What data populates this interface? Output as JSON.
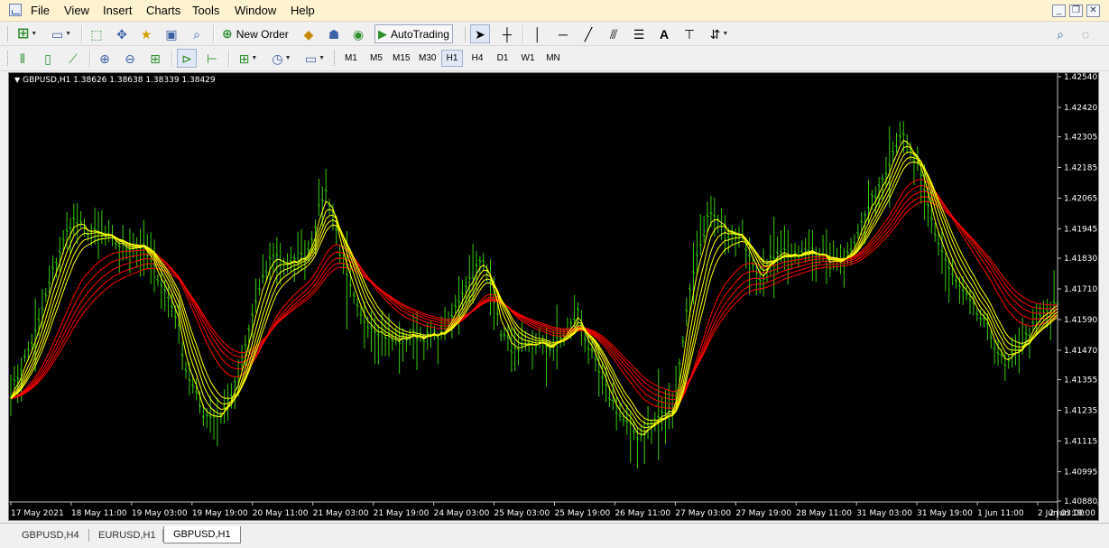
{
  "menubar": {
    "items": [
      "File",
      "View",
      "Insert",
      "Charts",
      "Tools",
      "Window",
      "Help"
    ],
    "window_controls": [
      "minimize",
      "restore",
      "close"
    ]
  },
  "toolbar": {
    "new_order_label": "New Order",
    "autotrading_label": "AutoTrading",
    "timeframes": [
      "M1",
      "M5",
      "M15",
      "M30",
      "H1",
      "H4",
      "D1",
      "W1",
      "MN"
    ],
    "active_timeframe": "H1",
    "text_tool_label": "A"
  },
  "chart": {
    "title": "GBPUSD,H1  1.38626 1.38638 1.38339 1.38429",
    "colors": {
      "background": "#000000",
      "bars": "#33cc00",
      "fast_ma": "#ffff00",
      "slow_ma": "#ff0000"
    }
  },
  "chart_data": {
    "type": "line",
    "symbol": "GBPUSD",
    "timeframe": "H1",
    "ohlc_header": [
      1.38626,
      1.38638,
      1.38339,
      1.38429
    ],
    "x_tick_labels": [
      "17 May 2021",
      "18 May 11:00",
      "19 May 03:00",
      "19 May 19:00",
      "20 May 11:00",
      "21 May 03:00",
      "21 May 19:00",
      "24 May 03:00",
      "25 May 03:00",
      "25 May 19:00",
      "26 May 11:00",
      "27 May 03:00",
      "27 May 19:00",
      "28 May 11:00",
      "31 May 03:00",
      "31 May 19:00",
      "1 Jun 11:00",
      "2 Jun 03:00",
      "2 Jun 19:00"
    ],
    "y_tick_labels": [
      "1.42540",
      "1.42420",
      "1.42305",
      "1.42185",
      "1.42065",
      "1.41945",
      "1.41830",
      "1.41710",
      "1.41590",
      "1.41470",
      "1.41355",
      "1.41235",
      "1.41115",
      "1.40995",
      "1.40880"
    ],
    "ylim": [
      1.4088,
      1.4254
    ],
    "grid": false,
    "price_path": [
      [
        0,
        1.413
      ],
      [
        3,
        1.4155
      ],
      [
        5,
        1.418
      ],
      [
        7,
        1.4198
      ],
      [
        9,
        1.4193
      ],
      [
        11,
        1.4191
      ],
      [
        13,
        1.4187
      ],
      [
        15,
        1.4188
      ],
      [
        17,
        1.4175
      ],
      [
        19,
        1.416
      ],
      [
        20,
        1.414
      ],
      [
        22,
        1.4122
      ],
      [
        24,
        1.4121
      ],
      [
        26,
        1.4135
      ],
      [
        28,
        1.4165
      ],
      [
        30,
        1.4185
      ],
      [
        32,
        1.418
      ],
      [
        34,
        1.4185
      ],
      [
        36,
        1.421
      ],
      [
        37,
        1.42
      ],
      [
        38,
        1.418
      ],
      [
        40,
        1.416
      ],
      [
        42,
        1.4155
      ],
      [
        44,
        1.415
      ],
      [
        46,
        1.4153
      ],
      [
        48,
        1.4152
      ],
      [
        50,
        1.4155
      ],
      [
        52,
        1.4172
      ],
      [
        54,
        1.4182
      ],
      [
        55,
        1.4175
      ],
      [
        56,
        1.4155
      ],
      [
        58,
        1.4145
      ],
      [
        60,
        1.415
      ],
      [
        62,
        1.4148
      ],
      [
        64,
        1.4155
      ],
      [
        65,
        1.4162
      ],
      [
        66,
        1.415
      ],
      [
        68,
        1.4133
      ],
      [
        70,
        1.412
      ],
      [
        72,
        1.4113
      ],
      [
        74,
        1.412
      ],
      [
        76,
        1.4125
      ],
      [
        78,
        1.4175
      ],
      [
        80,
        1.42
      ],
      [
        82,
        1.4193
      ],
      [
        84,
        1.419
      ],
      [
        86,
        1.4175
      ],
      [
        88,
        1.4187
      ],
      [
        90,
        1.4183
      ],
      [
        92,
        1.4187
      ],
      [
        94,
        1.418
      ],
      [
        96,
        1.4185
      ],
      [
        98,
        1.42
      ],
      [
        100,
        1.4215
      ],
      [
        102,
        1.4232
      ],
      [
        104,
        1.4218
      ],
      [
        106,
        1.4192
      ],
      [
        108,
        1.4175
      ],
      [
        110,
        1.4165
      ],
      [
        112,
        1.4155
      ],
      [
        114,
        1.414
      ],
      [
        116,
        1.415
      ],
      [
        118,
        1.416
      ],
      [
        120,
        1.4165
      ]
    ],
    "series": [
      {
        "color": "#ffff00",
        "group": "fast",
        "periods": [
          3,
          5,
          7,
          9,
          11
        ]
      },
      {
        "color": "#ff0000",
        "group": "slow",
        "periods": [
          20,
          24,
          28,
          32,
          36
        ]
      }
    ]
  },
  "tabs": [
    {
      "label": "GBPUSD,H4",
      "active": false
    },
    {
      "label": "EURUSD,H1",
      "active": false
    },
    {
      "label": "GBPUSD,H1",
      "active": true
    }
  ]
}
